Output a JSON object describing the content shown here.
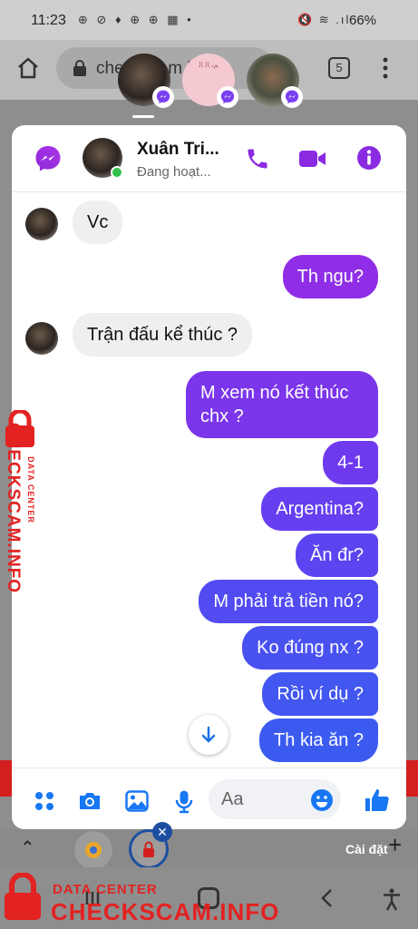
{
  "status_bar": {
    "time": "11:23",
    "left_icons": "⊕ ⊘ ♦ ⊕ ⊕ ▦ •",
    "right_icons": "🔇 ≋ .ıl",
    "battery": "66%"
  },
  "browser": {
    "url": "checkscam.info",
    "tabs_count": "5"
  },
  "chat_heads": {
    "second_text": "ﻢﺑ ﺎﻟ ﺎﻟ"
  },
  "chat": {
    "contact_name": "Xuân Tri...",
    "contact_status": "Đang hoạt...",
    "composer_placeholder": "Aa",
    "messages": [
      {
        "side": "in",
        "text": "Vc"
      },
      {
        "side": "out",
        "text": "Th ngu?"
      },
      {
        "side": "in",
        "text": "Trận đấu kể thúc ?"
      },
      {
        "side": "out",
        "text": "M xem nó kết thúc chx ?"
      },
      {
        "side": "out",
        "text": "4-1"
      },
      {
        "side": "out",
        "text": "Argentina?"
      },
      {
        "side": "out",
        "text": "Ăn đr?"
      },
      {
        "side": "out",
        "text": "M phải trả tiền nó?"
      },
      {
        "side": "out",
        "text": "Ko đúng nx ?"
      },
      {
        "side": "out",
        "text": "Rồi ví dụ ?"
      },
      {
        "side": "out",
        "text": "Th kia ăn ?"
      }
    ]
  },
  "bottom_toolbar": {
    "label": "Cài đặt"
  },
  "watermark": {
    "brand": "CHECKSCAM.INFO",
    "tag": "DATA CENTER"
  },
  "colors": {
    "accent": "#8a2be2",
    "bubble_top": "#8f2ee6",
    "bubble_bottom": "#3b5bf0",
    "watermark": "#e32222"
  }
}
